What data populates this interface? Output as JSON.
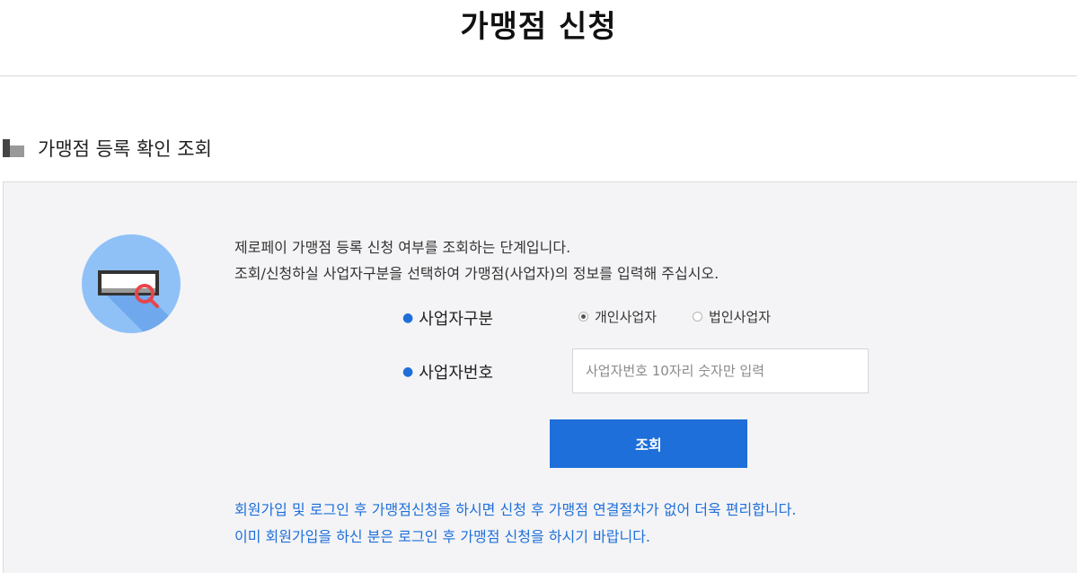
{
  "page": {
    "title": "가맹점 신청"
  },
  "section": {
    "title": "가맹점 등록 확인 조회"
  },
  "description": {
    "line1": "제로페이 가맹점 등록 신청 여부를 조회하는 단계입니다.",
    "line2": "조회/신청하실 사업자구분을 선택하여 가맹점(사업자)의 정보를 입력해 주십시오."
  },
  "form": {
    "biz_type_label": "사업자구분",
    "biz_type_options": [
      "개인사업자",
      "법인사업자"
    ],
    "biz_type_selected": "개인사업자",
    "biz_number_label": "사업자번호",
    "biz_number_placeholder": "사업자번호 10자리 숫자만 입력",
    "biz_number_value": "",
    "submit_label": "조회"
  },
  "notice": {
    "line1": "회원가입 및 로그인 후 가맹점신청을 하시면 신청 후 가맹점 연결절차가 없어 더욱 편리합니다.",
    "line2": "이미 회원가입을 하신 분은 로그인 후 가맹점 신청을 하시기 바랍니다."
  },
  "colors": {
    "accent": "#1e6fd9",
    "panel_bg": "#f4f4f6",
    "illus_bg": "#8fc1f7"
  },
  "icons": {
    "section": "section-block-icon",
    "illustration": "search-card-icon"
  }
}
